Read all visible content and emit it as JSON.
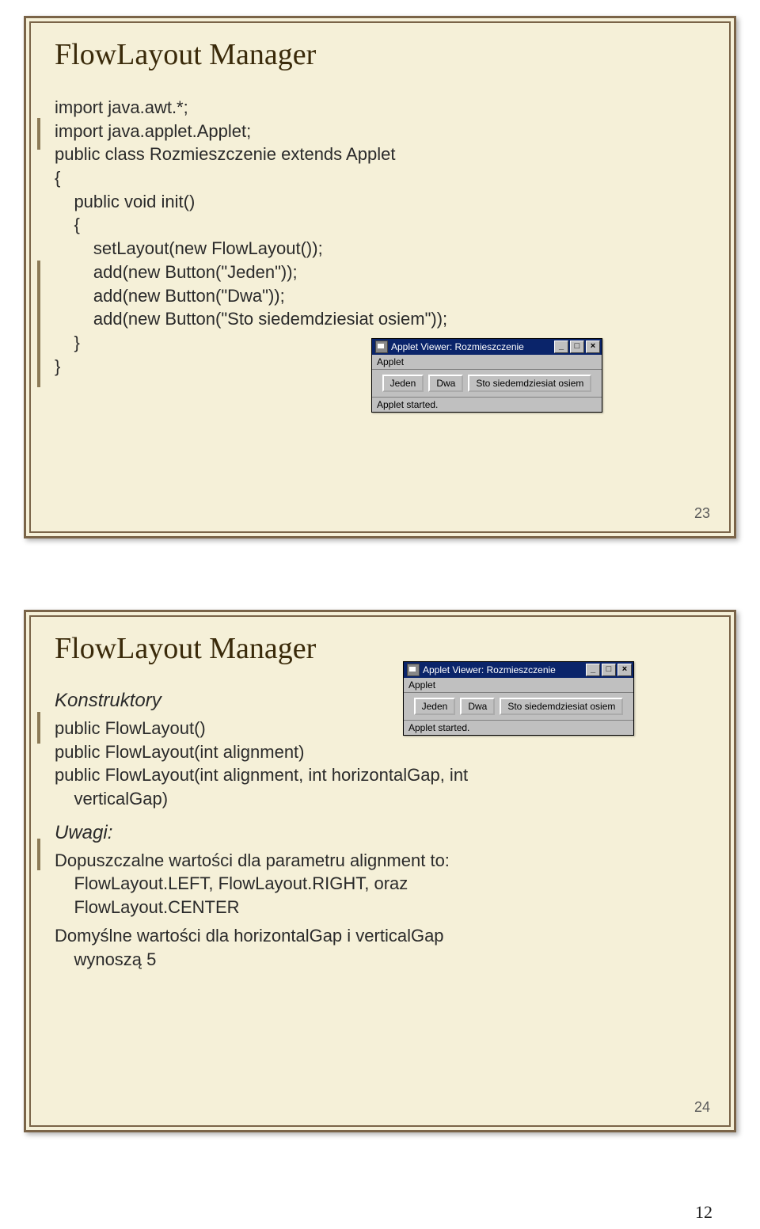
{
  "slide1": {
    "title": "FlowLayout Manager",
    "code": "import java.awt.*;\nimport java.applet.Applet;\npublic class Rozmieszczenie extends Applet\n{\n    public void init()\n    {\n        setLayout(new FlowLayout());\n        add(new Button(\"Jeden\"));\n        add(new Button(\"Dwa\"));\n        add(new Button(\"Sto siedemdziesiat osiem\"));\n    }\n}",
    "pagenum": "23",
    "applet": {
      "title": "Applet Viewer: Rozmieszczenie",
      "menu": "Applet",
      "btn1": "Jeden",
      "btn2": "Dwa",
      "btn3": "Sto siedemdziesiat osiem",
      "status": "Applet started."
    }
  },
  "slide2": {
    "title": "FlowLayout Manager",
    "heading1": "Konstruktory",
    "line1": "public FlowLayout()",
    "line2": "public FlowLayout(int alignment)",
    "line3": "public FlowLayout(int alignment, int horizontalGap, int\n    verticalGap)",
    "heading2": "Uwagi:",
    "note1": "Dopuszczalne wartości dla parametru alignment to:\n    FlowLayout.LEFT, FlowLayout.RIGHT, oraz\n    FlowLayout.CENTER",
    "note2": "Domyślne wartości dla horizontalGap i verticalGap\n    wynoszą 5",
    "pagenum": "24",
    "applet": {
      "title": "Applet Viewer: Rozmieszczenie",
      "menu": "Applet",
      "btn1": "Jeden",
      "btn2": "Dwa",
      "btn3": "Sto siedemdziesiat osiem",
      "status": "Applet started."
    }
  },
  "footnum": "12",
  "winbtns": {
    "min": "_",
    "max": "□",
    "close": "×"
  }
}
